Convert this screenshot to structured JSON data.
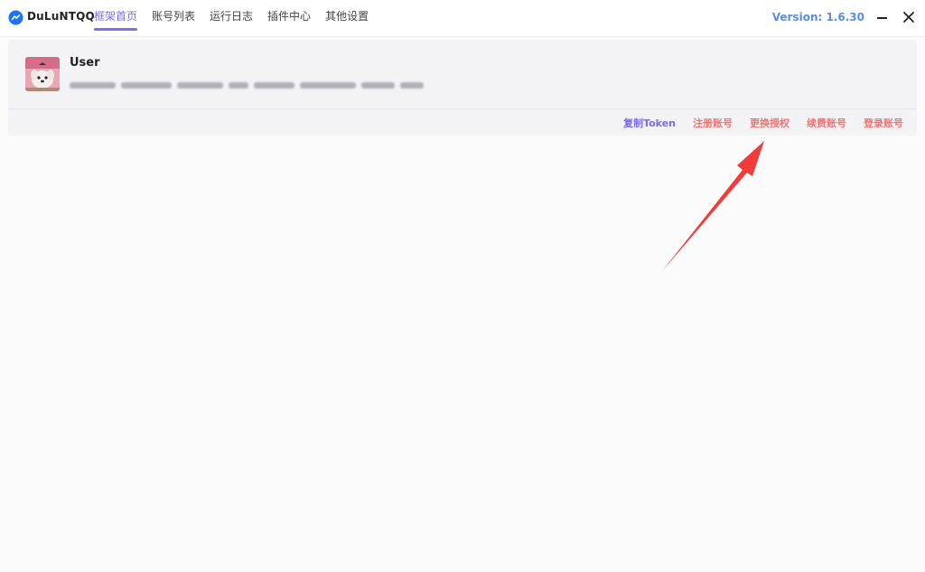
{
  "app": {
    "name": "DuLuNTQQ",
    "version": "Version: 1.6.30",
    "logo_icon": "chat-bubble-icon",
    "accent_color": "#7c6ee6",
    "version_color": "#5c8de6"
  },
  "tabs": [
    {
      "label": "框架首页",
      "active": true
    },
    {
      "label": "账号列表",
      "active": false
    },
    {
      "label": "运行日志",
      "active": false
    },
    {
      "label": "插件中心",
      "active": false
    },
    {
      "label": "其他设置",
      "active": false
    }
  ],
  "account": {
    "username": "User",
    "avatar_icon": "user-avatar-icon"
  },
  "actions": [
    {
      "label": "复制Token",
      "style": "primary",
      "color": "#7b6be0"
    },
    {
      "label": "注册账号",
      "style": "danger",
      "color": "#f07474"
    },
    {
      "label": "更换授权",
      "style": "danger",
      "color": "#f07474"
    },
    {
      "label": "续费账号",
      "style": "danger",
      "color": "#f07474"
    },
    {
      "label": "登录账号",
      "style": "danger",
      "color": "#f07474"
    }
  ],
  "annotation": {
    "arrow_icon": "red-arrow-annotation-icon",
    "arrow_color": "#f23b3b"
  }
}
